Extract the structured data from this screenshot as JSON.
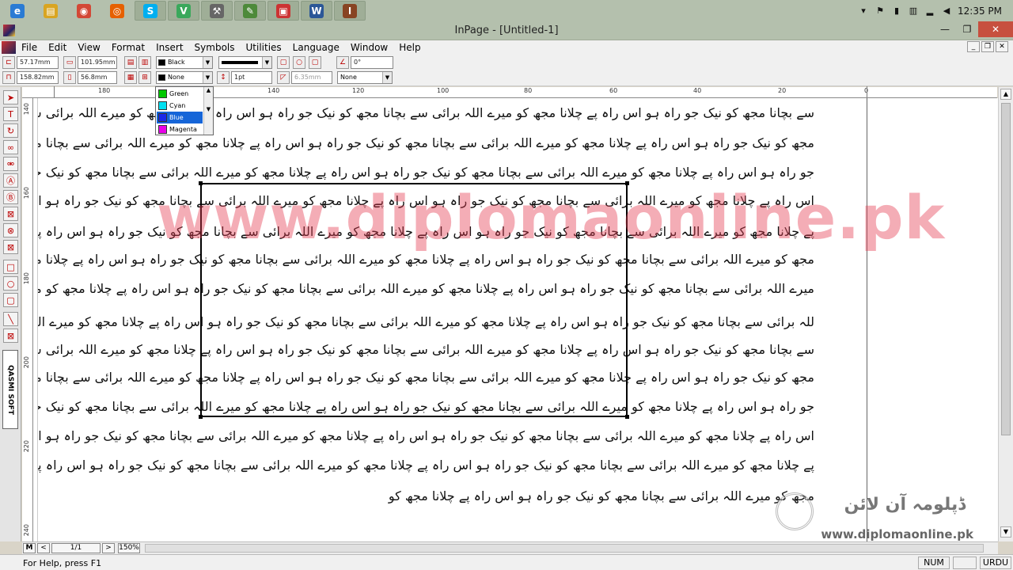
{
  "taskbar": {
    "apps": [
      {
        "name": "ie",
        "icon": "e",
        "color": "#2a7bd4"
      },
      {
        "name": "explorer",
        "icon": "▤",
        "color": "#d9a521"
      },
      {
        "name": "chrome",
        "icon": "◉",
        "color": "#d34836"
      },
      {
        "name": "firefox",
        "icon": "◎",
        "color": "#e66000"
      },
      {
        "name": "skype",
        "icon": "S",
        "color": "#00aff0"
      },
      {
        "name": "vine",
        "icon": "V",
        "color": "#3aa85b"
      },
      {
        "name": "tool",
        "icon": "⚒",
        "color": "#666666"
      },
      {
        "name": "notepad",
        "icon": "✎",
        "color": "#4d8a3a"
      },
      {
        "name": "pdf",
        "icon": "▣",
        "color": "#cc3333"
      },
      {
        "name": "word",
        "icon": "W",
        "color": "#2b5797"
      },
      {
        "name": "inpage",
        "icon": "ا",
        "color": "#884422"
      }
    ],
    "clock": "12:35 PM"
  },
  "window": {
    "title": "InPage - [Untitled-1]",
    "min": "—",
    "max": "❐",
    "close": "✕"
  },
  "menu": {
    "items": [
      "File",
      "Edit",
      "View",
      "Format",
      "Insert",
      "Symbols",
      "Utilities",
      "Language",
      "Window",
      "Help"
    ]
  },
  "toolbar": {
    "x_pos": "57.17mm",
    "width": "101.95mm",
    "y_pos": "158.82mm",
    "height": "56.8mm",
    "line_color": "Black",
    "fill_color": "None",
    "line_weight": "1pt",
    "corner": "6.35mm",
    "angle": "0°",
    "shade": "None"
  },
  "color_dropdown": {
    "options": [
      {
        "label": "Green",
        "color": "#00c800"
      },
      {
        "label": "Cyan",
        "color": "#00e0f0"
      },
      {
        "label": "Blue",
        "color": "#1a28e8"
      },
      {
        "label": "Magenta",
        "color": "#e800e8"
      }
    ],
    "selected": "Blue"
  },
  "ruler": {
    "h_labels": [
      "180",
      "140",
      "120",
      "100",
      "80",
      "60",
      "40",
      "20",
      "0"
    ],
    "v_labels": [
      "140",
      "160",
      "180",
      "200",
      "220",
      "240"
    ]
  },
  "document": {
    "lines": [
      "سے بچانا مجھ کو نیک جو راہ ہو اس راہ پے چلانا مجھ کو میرے اللہ برائی سے بچانا مجھ کو نیک جو راہ ہو اس راہ پے چلانا مجھ کو میرے اللہ برائی سے بچانا",
      "مجھ کو نیک جو راہ ہو اس راہ پے چلانا مجھ کو میرے اللہ برائی سے بچانا مجھ کو نیک جو راہ ہو اس راہ پے چلانا مجھ کو میرے اللہ برائی سے بچانا مجھ کو نیک",
      "جو راہ ہو اس راہ پے چلانا مجھ کو میرے اللہ برائی سے بچانا مجھ کو نیک جو راہ ہو اس راہ پے چلانا مجھ کو میرے اللہ برائی سے بچانا مجھ کو نیک جو راہ ہو",
      "اس راہ پے چلانا مجھ کو میرے اللہ برائی سے بچانا مجھ کو نیک جو راہ ہو اس راہ پے چلانا مجھ کو میرے اللہ برائی سے بچانا مجھ کو نیک جو راہ ہو اس راہ",
      "پے چلانا مجھ کو میرے اللہ برائی سے بچانا مجھ کو نیک جو راہ ہو اس راہ پے چلانا مجھ کو میرے اللہ برائی سے بچانا مجھ کو نیک جو راہ ہو اس راہ پے چلانا",
      "مجھ کو میرے اللہ برائی سے بچانا مجھ کو نیک جو راہ ہو اس راہ پے چلانا مجھ کو میرے اللہ برائی سے بچانا مجھ کو نیک جو راہ ہو اس راہ پے چلانا مجھ کو",
      "میرے اللہ برائی سے بچانا مجھ کو نیک جو راہ ہو اس راہ پے چلانا مجھ کو میرے اللہ برائی سے بچانا مجھ کو نیک جو راہ ہو اس راہ پے چلانا مجھ کو میرے ا",
      "للہ برائی سے بچانا مجھ کو نیک جو راہ ہو اس راہ پے چلانا مجھ کو میرے اللہ برائی سے بچانا مجھ کو نیک جو راہ ہو اس راہ پے چلانا مجھ کو میرے اللہ برائی",
      "سے بچانا مجھ کو نیک جو راہ ہو اس راہ پے چلانا مجھ کو میرے اللہ برائی سے بچانا مجھ کو نیک جو راہ ہو اس راہ پے چلانا مجھ کو میرے اللہ برائی سے بچانا",
      "مجھ کو نیک جو راہ ہو اس راہ پے چلانا مجھ کو میرے اللہ برائی سے بچانا مجھ کو نیک جو راہ ہو اس راہ پے چلانا مجھ کو میرے اللہ برائی سے بچانا مجھ کو نیک",
      "جو راہ ہو اس راہ پے چلانا مجھ کو میرے اللہ برائی سے بچانا مجھ کو نیک جو راہ ہو اس راہ پے چلانا مجھ کو میرے اللہ برائی سے بچانا مجھ کو نیک جو راہ ہو",
      "اس راہ پے چلانا مجھ کو میرے اللہ برائی سے بچانا مجھ کو نیک جو راہ ہو اس راہ پے چلانا مجھ کو میرے اللہ برائی سے بچانا مجھ کو نیک جو راہ ہو اس راہ",
      "پے چلانا مجھ کو میرے اللہ برائی سے بچانا مجھ کو نیک جو راہ ہو اس راہ پے چلانا مجھ کو میرے اللہ برائی سے بچانا مجھ کو نیک جو راہ ہو اس راہ پے چلانا",
      "مجھ کو میرے اللہ برائی سے بچانا مجھ کو نیک جو راہ ہو اس راہ پے چلانا مجھ کو"
    ]
  },
  "watermark": {
    "text": "www.diplomaonline.pk",
    "logo_urdu": "ڈپلومہ آن لائن",
    "logo_url": "www.diplomaonline.pk"
  },
  "palette": {
    "brand": "QASMI SOFT"
  },
  "navigation": {
    "master": "M",
    "prev": "<",
    "page": "1/1",
    "next": ">",
    "zoom": "150%"
  },
  "status": {
    "help": "For Help, press F1",
    "num": "NUM",
    "lang": "URDU"
  }
}
